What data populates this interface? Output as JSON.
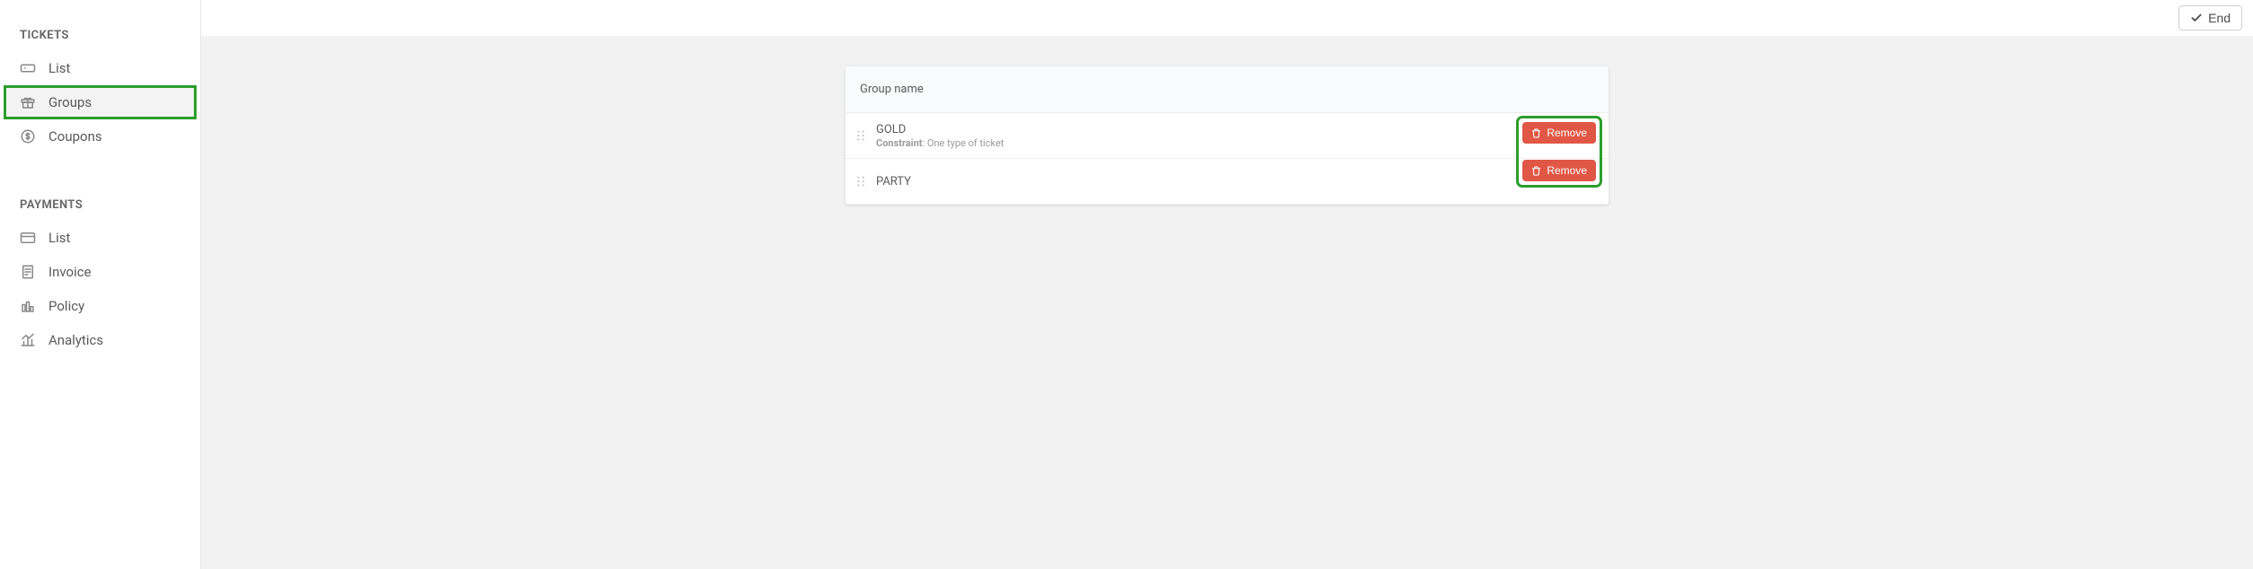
{
  "sidebar": {
    "tickets": {
      "title": "TICKETS",
      "items": [
        {
          "label": "List",
          "key": "list"
        },
        {
          "label": "Groups",
          "key": "groups"
        },
        {
          "label": "Coupons",
          "key": "coupons"
        }
      ]
    },
    "payments": {
      "title": "PAYMENTS",
      "items": [
        {
          "label": "List",
          "key": "list"
        },
        {
          "label": "Invoice",
          "key": "invoice"
        },
        {
          "label": "Policy",
          "key": "policy"
        },
        {
          "label": "Analytics",
          "key": "analytics"
        }
      ]
    }
  },
  "topbar": {
    "end_label": "End"
  },
  "card": {
    "header": "Group name",
    "rows": [
      {
        "name": "GOLD",
        "constraint_label": "Constraint",
        "constraint_value": "One type of ticket",
        "remove_label": "Remove"
      },
      {
        "name": "PARTY",
        "remove_label": "Remove"
      }
    ]
  }
}
